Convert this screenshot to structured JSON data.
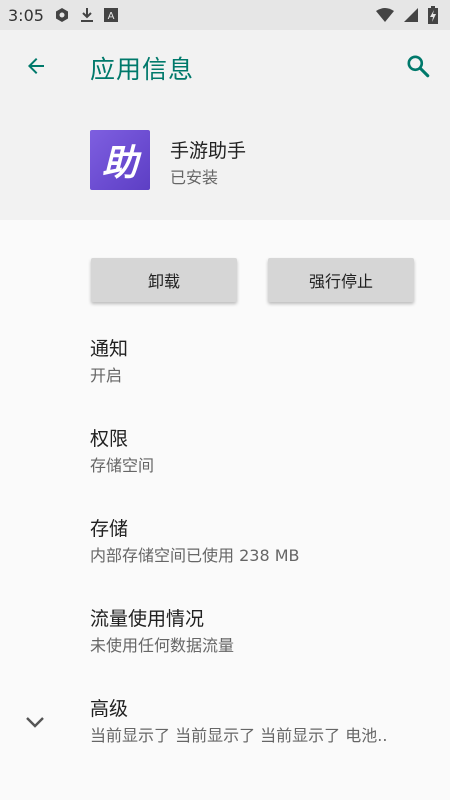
{
  "status_bar": {
    "time": "3:05",
    "left_icons": [
      "app-notification-icon",
      "download-icon",
      "text-input-icon"
    ],
    "right_icons": [
      "wifi-icon",
      "cellular-signal-icon",
      "battery-charging-icon"
    ]
  },
  "header": {
    "title": "应用信息",
    "back_icon": "arrow-back-icon",
    "search_icon": "search-icon"
  },
  "app": {
    "icon_text": "助",
    "name": "手游助手",
    "status": "已安装"
  },
  "buttons": {
    "uninstall": "卸载",
    "force_stop": "强行停止"
  },
  "settings": [
    {
      "title": "通知",
      "summary": "开启"
    },
    {
      "title": "权限",
      "summary": "存储空间"
    },
    {
      "title": "存储",
      "summary": "内部存储空间已使用 238 MB"
    },
    {
      "title": "流量使用情况",
      "summary": "未使用任何数据流量"
    },
    {
      "title": "高级",
      "summary": "当前显示了 当前显示了 当前显示了 电池.."
    }
  ],
  "colors": {
    "accent": "#00796b",
    "app_icon_bg": "#6a4bd0"
  }
}
